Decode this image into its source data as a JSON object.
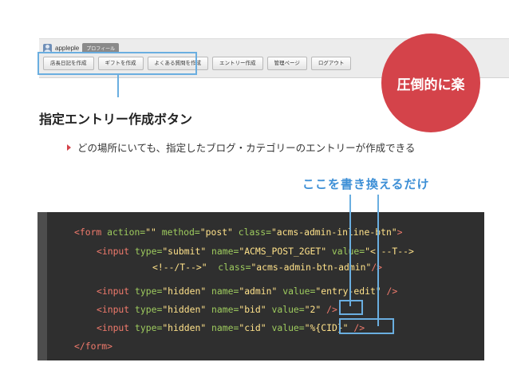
{
  "adminbar": {
    "username": "appleple",
    "profile_label": "プロフィール",
    "buttons": [
      "店長日記を作成",
      "ギフトを作成",
      "よくある質問を作成",
      "エントリー作成",
      "管理ページ",
      "ログアウト"
    ]
  },
  "badge": {
    "label": "圧倒的に楽",
    "color": "#d4434a"
  },
  "heading": "指定エントリー作成ボタン",
  "bullet": "どの場所にいても、指定したブログ・カテゴリーのエントリーが作成できる",
  "callout": "ここを書き換えるだけ",
  "code": {
    "line1": {
      "tag_open": "<form",
      "attr1": " action=",
      "val1": "\"\"",
      "attr2": " method=",
      "val2": "\"post\"",
      "attr3": " class=",
      "val3": "\"acms-admin-inline-btn\"",
      "close": ">"
    },
    "line2": {
      "tag_open": "<input",
      "attr1": " type=",
      "val1": "\"submit\"",
      "attr2": " name=",
      "val2": "\"ACMS_POST_2GET\"",
      "attr3": " value=",
      "val3": "\"<!--T-->"
    },
    "line3": {
      "val3b": "<!--/T-->\"",
      "attr4": "  class=",
      "val4": "\"acms-admin-btn-admin\"",
      "close": "/>"
    },
    "line4": {
      "tag_open": "<input",
      "attr1": " type=",
      "val1": "\"hidden\"",
      "attr2": " name=",
      "val2": "\"admin\"",
      "attr3": " value=",
      "val3": "\"entry-edit\"",
      "close": " />"
    },
    "line5": {
      "tag_open": "<input",
      "attr1": " type=",
      "val1": "\"hidden\"",
      "attr2": " name=",
      "val2": "\"bid\"",
      "attr3": " value=",
      "val3": "\"2\"",
      "close": " />"
    },
    "line6": {
      "tag_open": "<input",
      "attr1": " type=",
      "val1": "\"hidden\"",
      "attr2": " name=",
      "val2": "\"cid\"",
      "attr3": " value=",
      "val3": "\"%{CID}\"",
      "close": " />"
    },
    "line7": {
      "tag_close": "</form",
      "close": ">"
    }
  }
}
